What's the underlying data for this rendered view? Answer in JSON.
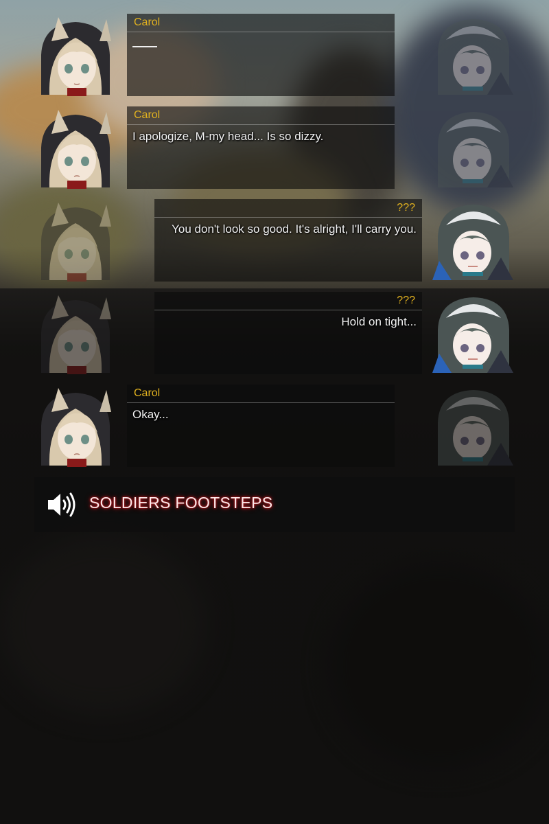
{
  "messages": [
    {
      "side": "left",
      "speaker": "Carol",
      "text": "",
      "text_placeholder_dash": true
    },
    {
      "side": "left",
      "speaker": "Carol",
      "text": "I apologize, M-my head... Is so dizzy."
    },
    {
      "side": "right",
      "speaker": "???",
      "text": "You don't look so good. It's alright, I'll carry you."
    },
    {
      "side": "right",
      "speaker": "???",
      "text": "Hold on tight..."
    },
    {
      "side": "left",
      "speaker": "Carol",
      "text": "Okay..."
    }
  ],
  "sfx": {
    "label": "SOLDIERS FOOTSTEPS",
    "icon": "speaker-icon"
  },
  "colors": {
    "speaker_name": "#e2b21f",
    "sfx_glow": "#b2161c"
  }
}
